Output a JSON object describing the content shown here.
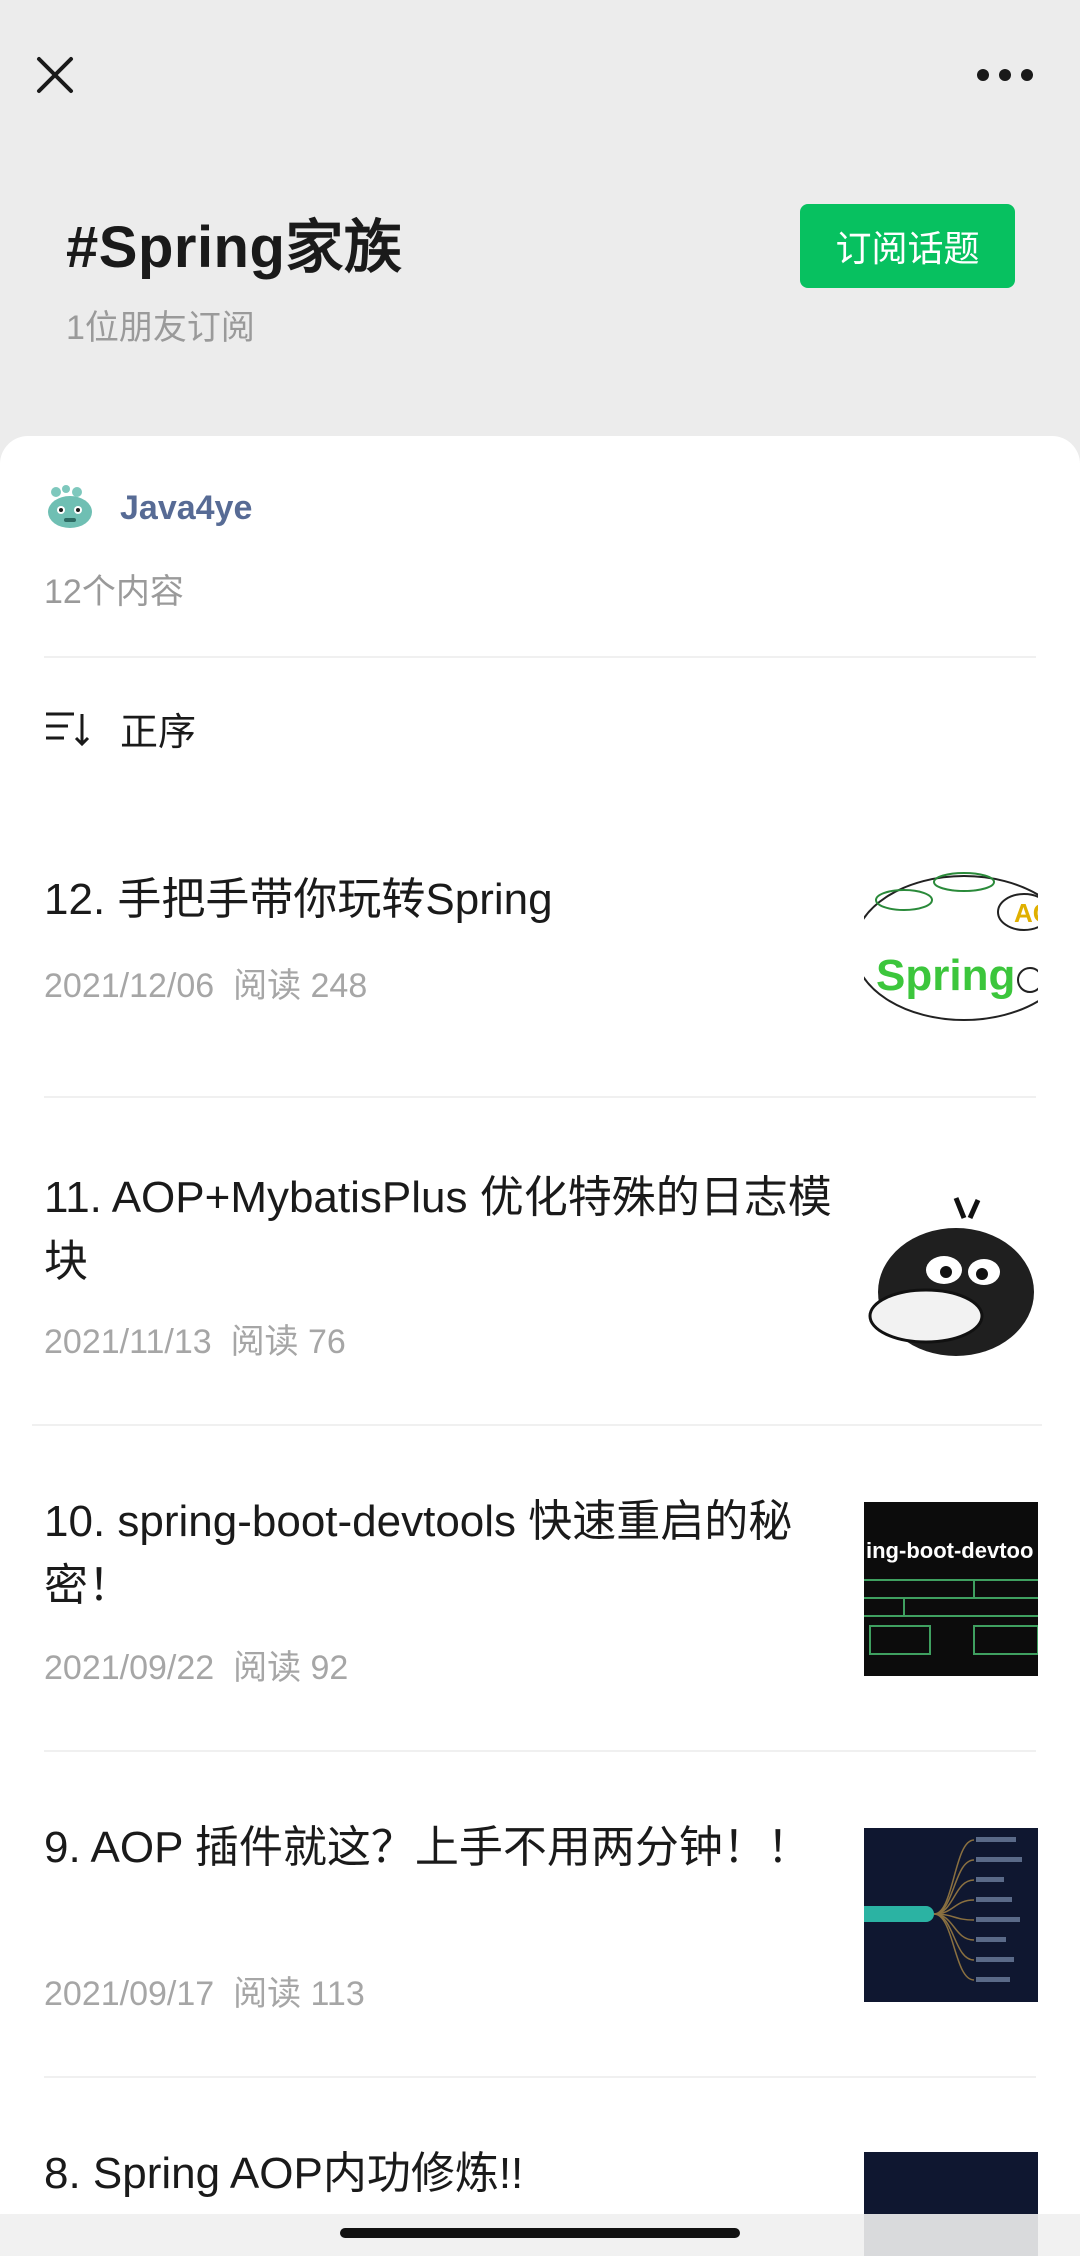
{
  "topic": {
    "title": "#Spring家族",
    "subscribers": "1位朋友订阅",
    "subscribe_label": "订阅话题"
  },
  "account": {
    "name": "Java4ye",
    "content_count": "12个内容"
  },
  "sort": {
    "label": "正序"
  },
  "icons": {
    "close": "close-icon",
    "more": "more-dots-icon",
    "sort": "sort-icon",
    "avatar": "java4ye-avatar"
  },
  "colors": {
    "accent_green": "#07c160",
    "account_name": "#576b95",
    "muted_text": "#9a9a9a",
    "header_bg": "#ececec"
  },
  "articles": [
    {
      "title": "12. 手把手带你玩转Spring",
      "date": "2021/12/06",
      "reads": "阅读 248",
      "thumb_text": "Spring"
    },
    {
      "title": "11. AOP+MybatisPlus 优化特殊的日志模块",
      "date": "2021/11/13",
      "reads": "阅读 76",
      "thumb_text": ""
    },
    {
      "title": "10. spring-boot-devtools 快速重启的秘密！",
      "date": "2021/09/22",
      "reads": "阅读 92",
      "thumb_text": "ing-boot-devtoo"
    },
    {
      "title": "9. AOP 插件就这？上手不用两分钟！！",
      "date": "2021/09/17",
      "reads": "阅读 113",
      "thumb_text": ""
    },
    {
      "title": "8. Spring AOP内功修炼!!",
      "date": "",
      "reads": "",
      "thumb_text": ""
    }
  ]
}
